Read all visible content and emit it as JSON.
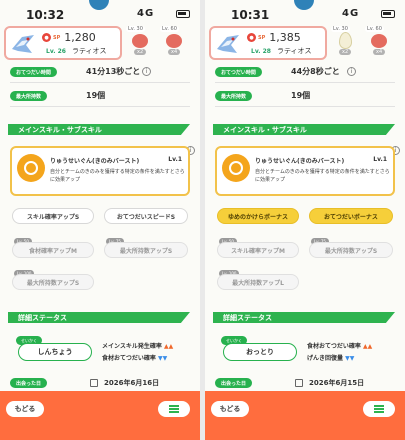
{
  "panels": [
    {
      "status_time": "10:32",
      "signal": "4G",
      "pokemon": {
        "sp_label": "SP",
        "sp": "1,280",
        "level": "Lv. 26",
        "name": "ラティオス"
      },
      "slots": [
        {
          "level": "Lv. 30",
          "kind": "berry",
          "count": "x2"
        },
        {
          "level": "Lv. 60",
          "kind": "berry",
          "count": "x4"
        }
      ],
      "rows": [
        {
          "label": "おてつだい時間",
          "value": "41分13秒ごと"
        },
        {
          "label": "最大所持数",
          "value": "19個"
        }
      ],
      "section_skills": "メインスキル・サブスキル",
      "main_skill": {
        "name": "りゅうせいぐん(きのみバースト)",
        "level": "Lv.1",
        "desc": "自分とチームのきのみを獲得する特定の条件を満たすとさらに効果アップ"
      },
      "sub_skills": [
        {
          "label": "スキル確率アップS",
          "state": "normal",
          "lv": ""
        },
        {
          "label": "おてつだいスピードS",
          "state": "normal",
          "lv": ""
        },
        {
          "label": "食材確率アップM",
          "state": "locked",
          "lv": "Lv. 50"
        },
        {
          "label": "最大所持数アップS",
          "state": "locked",
          "lv": "Lv. 75"
        },
        {
          "label": "最大所持数アップS",
          "state": "locked",
          "lv": "Lv. 100"
        }
      ],
      "section_status": "詳細ステータス",
      "nature_label": "せいかく",
      "nature": "しんちょう",
      "nature_up": "メインスキル発生確率",
      "nature_up_mark": "▲▲",
      "nature_down": "食材おてつだい確率",
      "nature_down_mark": "▼▼",
      "date_label": "出会った日",
      "date": "2026年6月16日",
      "back_label": "もどる"
    },
    {
      "status_time": "10:31",
      "signal": "4G",
      "pokemon": {
        "sp_label": "SP",
        "sp": "1,385",
        "level": "Lv. 28",
        "name": "ラティオス"
      },
      "slots": [
        {
          "level": "Lv. 30",
          "kind": "egg",
          "count": "x2"
        },
        {
          "level": "Lv. 60",
          "kind": "berry",
          "count": "x4"
        }
      ],
      "rows": [
        {
          "label": "おてつだい時間",
          "value": "44分8秒ごと"
        },
        {
          "label": "最大所持数",
          "value": "19個"
        }
      ],
      "section_skills": "メインスキル・サブスキル",
      "main_skill": {
        "name": "りゅうせいぐん(きのみバースト)",
        "level": "Lv.1",
        "desc": "自分とチームのきのみを獲得する特定の条件を満たすとさらに効果アップ"
      },
      "sub_skills": [
        {
          "label": "ゆめのかけらボーナス",
          "state": "active",
          "lv": ""
        },
        {
          "label": "おてつだいボーナス",
          "state": "active",
          "lv": ""
        },
        {
          "label": "スキル確率アップM",
          "state": "locked",
          "lv": "Lv. 50"
        },
        {
          "label": "最大所持数アップS",
          "state": "locked",
          "lv": "Lv. 75"
        },
        {
          "label": "最大所持数アップL",
          "state": "locked",
          "lv": "Lv. 100"
        }
      ],
      "section_status": "詳細ステータス",
      "nature_label": "せいかく",
      "nature": "おっとり",
      "nature_up": "食材おてつだい確率",
      "nature_up_mark": "▲▲",
      "nature_down": "げんき回復量",
      "nature_down_mark": "▼▼",
      "date_label": "出会った日",
      "date": "2026年6月15日",
      "back_label": "もどる"
    }
  ]
}
